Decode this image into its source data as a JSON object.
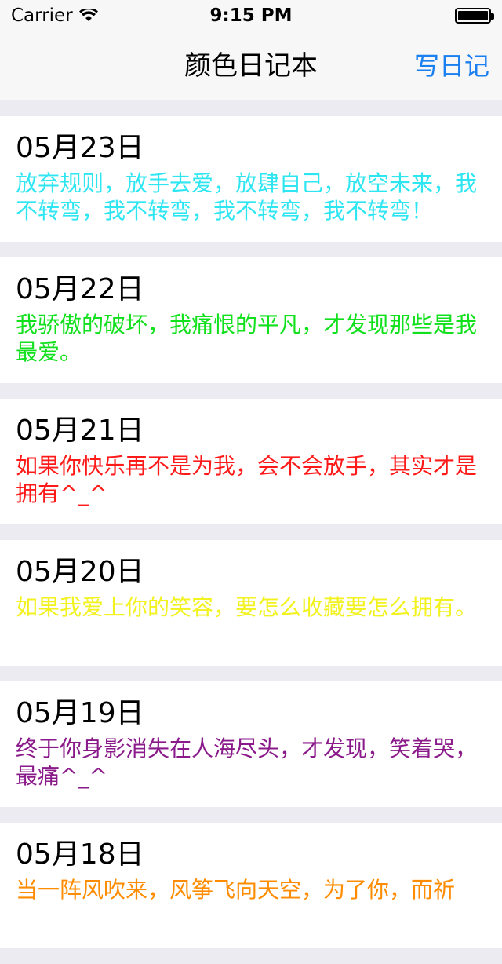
{
  "status": {
    "carrier": "Carrier",
    "time": "9:15 PM"
  },
  "nav": {
    "title": "颜色日记本",
    "action": "写日记"
  },
  "entries": [
    {
      "date": "05月23日",
      "text": "放弃规则，放手去爱，放肆自己，放空未来，我不转弯，我不转弯，我不转弯，我不转弯！",
      "color": "#2EE6F2"
    },
    {
      "date": "05月22日",
      "text": "我骄傲的破坏，我痛恨的平凡，才发现那些是我最爱。",
      "color": "#11E01C"
    },
    {
      "date": "05月21日",
      "text": "如果你快乐再不是为我，会不会放手，其实才是拥有^_^",
      "color": "#FF1A1A"
    },
    {
      "date": "05月20日",
      "text": "如果我爱上你的笑容，要怎么收藏要怎么拥有。",
      "color": "#F2F21E"
    },
    {
      "date": "05月19日",
      "text": "终于你身影消失在人海尽头，才发现，笑着哭，最痛^_^",
      "color": "#8A1A8A"
    },
    {
      "date": "05月18日",
      "text": "当一阵风吹来，风筝飞向天空，为了你，而祈",
      "color": "#FF8C00"
    }
  ]
}
